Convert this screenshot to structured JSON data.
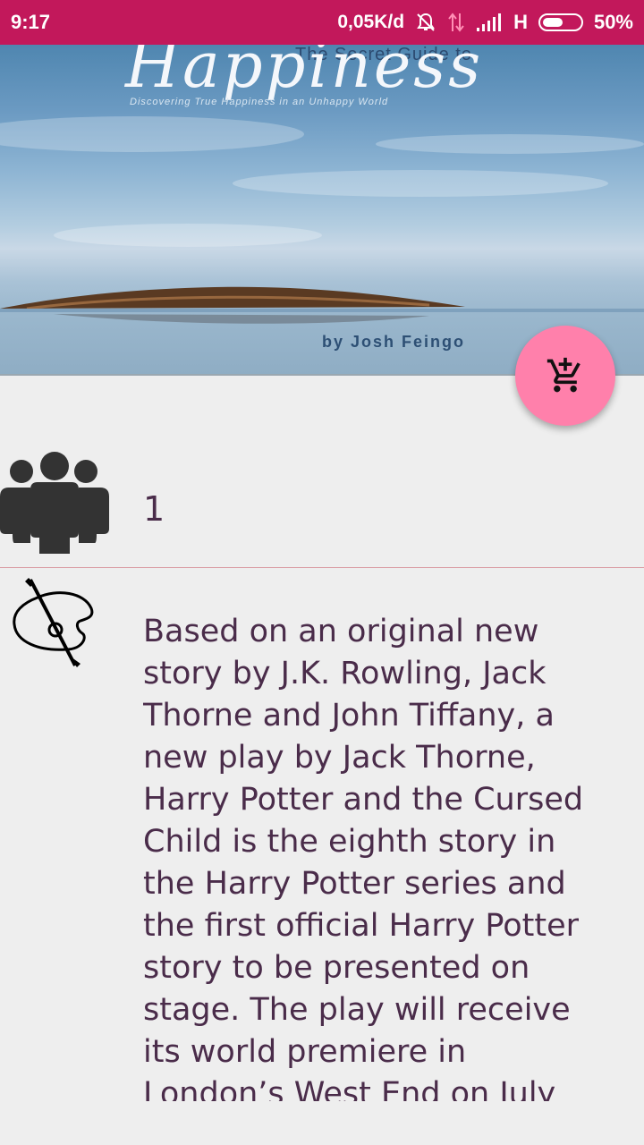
{
  "status_bar": {
    "time": "9:17",
    "network_speed": "0,05K/d",
    "network_type": "H",
    "battery": "50%",
    "icons": [
      "mute-icon",
      "data-arrows-icon",
      "signal-icon",
      "battery-icon"
    ]
  },
  "cover": {
    "subtitle": "The Secret Guide to",
    "title": "Happiness",
    "tagline": "Discovering True Happiness in an Unhappy World",
    "author": "by Josh Feingo"
  },
  "fab": {
    "icon": "add-shopping-cart-icon",
    "color": "#ff80ab"
  },
  "info": {
    "count_icon": "people-group-icon",
    "count": "1",
    "description_icon": "palette-brush-icon",
    "description": "Based on an original new story by J.K. Rowling, Jack Thorne and John Tiffany, a new play by Jack Thorne, Harry Potter and the Cursed Child is the eighth story in the Harry Potter series and the first official Harry Potter story to be presented on stage. The play will receive its world premiere in London’s West End on July"
  },
  "colors": {
    "status_bar": "#c2185b",
    "text": "#4a2c4a",
    "divider": "#d99aa2",
    "background": "#eeeeee"
  }
}
